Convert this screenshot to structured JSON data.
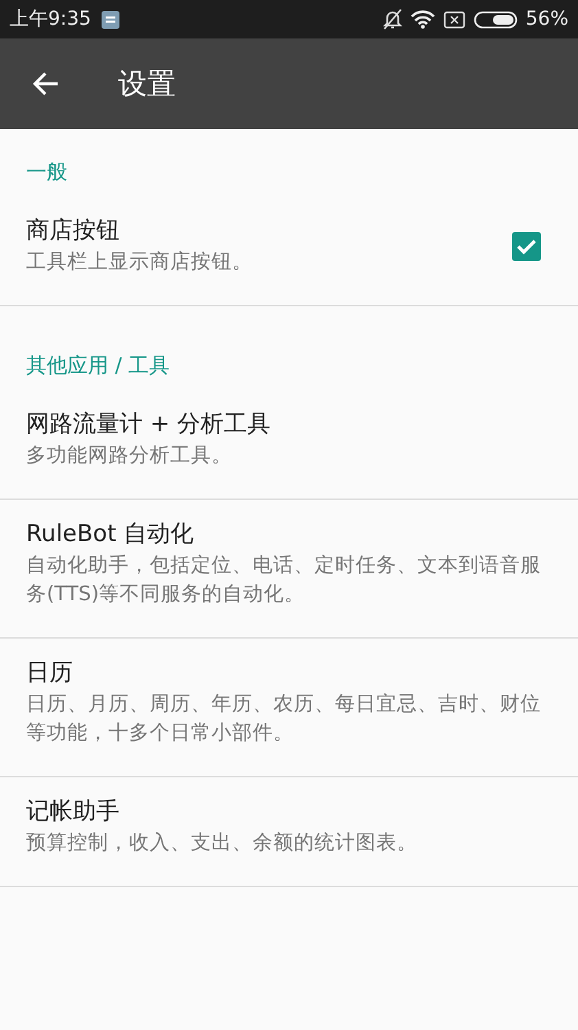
{
  "status_bar": {
    "time": "上午9:35",
    "battery": "56%"
  },
  "toolbar": {
    "title": "设置"
  },
  "sections": [
    {
      "header": "一般",
      "items": [
        {
          "kind": "checkbox",
          "title": "商店按钮",
          "summary": "工具栏上显示商店按钮。",
          "checked": true
        }
      ]
    },
    {
      "header": "其他应用 / 工具",
      "items": [
        {
          "kind": "link",
          "title": "网路流量计 + 分析工具",
          "summary": "多功能网路分析工具。"
        },
        {
          "kind": "link",
          "title": "RuleBot 自动化",
          "summary": "自动化助手，包括定位、电话、定时任务、文本到语音服务(TTS)等不同服务的自动化。"
        },
        {
          "kind": "link",
          "title": "日历",
          "summary": "日历、月历、周历、年历、农历、每日宜忌、吉时、财位等功能，十多个日常小部件。"
        },
        {
          "kind": "link",
          "title": "记帐助手",
          "summary": "预算控制，收入、支出、余额的统计图表。"
        }
      ]
    }
  ]
}
